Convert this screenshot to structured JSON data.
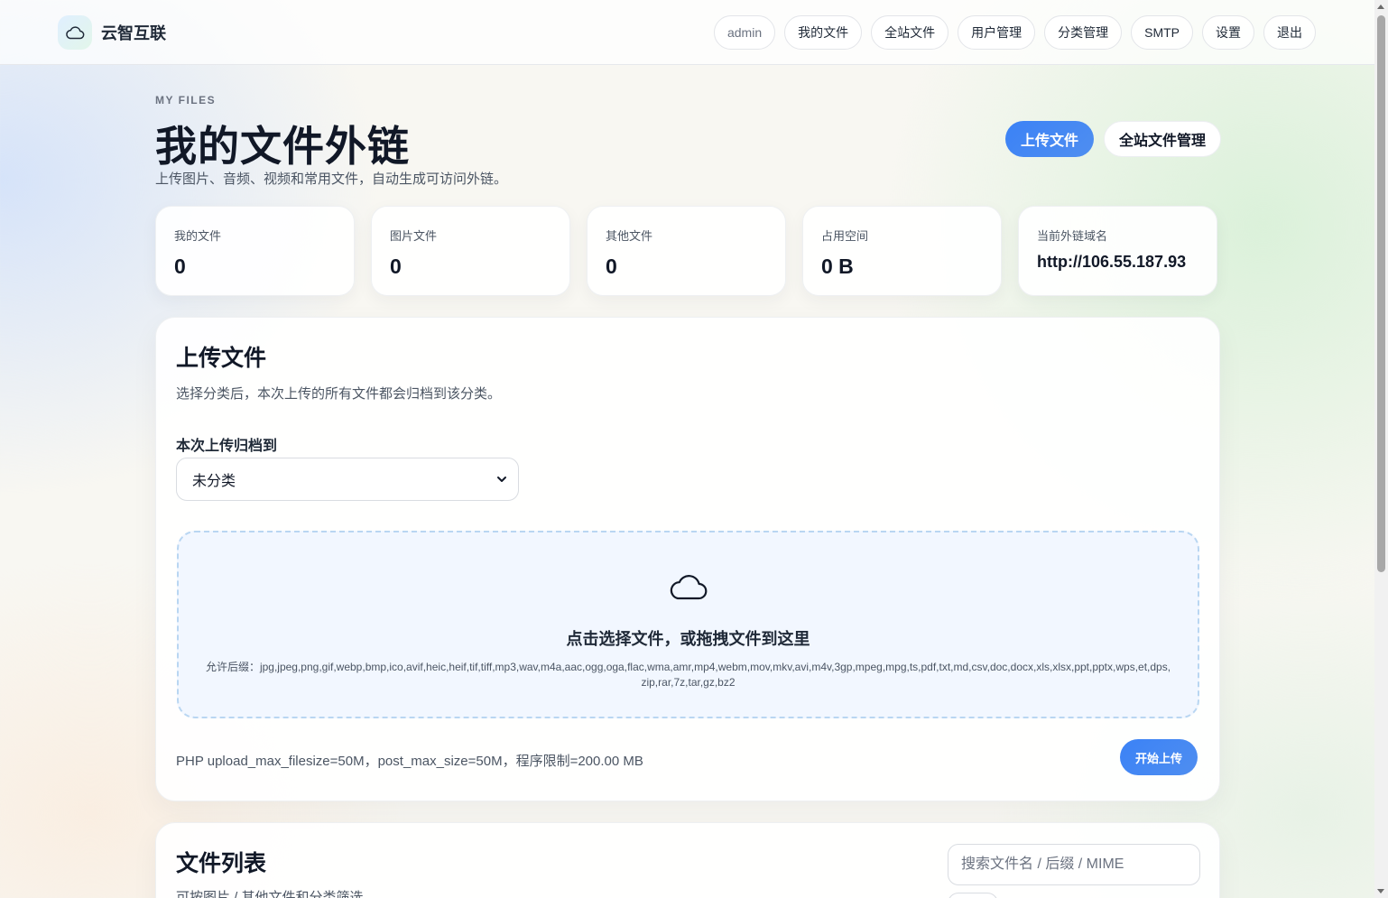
{
  "header": {
    "brand_name": "云智互联",
    "nav": {
      "user": "admin",
      "my_files": "我的文件",
      "site_files": "全站文件",
      "user_mgmt": "用户管理",
      "category_mgmt": "分类管理",
      "smtp": "SMTP",
      "settings": "设置",
      "logout": "退出"
    }
  },
  "hero": {
    "eyebrow": "MY FILES",
    "title": "我的文件外链",
    "subtitle": "上传图片、音频、视频和常用文件，自动生成可访问外链。",
    "upload_button": "上传文件",
    "site_files_button": "全站文件管理"
  },
  "stats": [
    {
      "label": "我的文件",
      "value": "0"
    },
    {
      "label": "图片文件",
      "value": "0"
    },
    {
      "label": "其他文件",
      "value": "0"
    },
    {
      "label": "占用空间",
      "value": "0 B"
    },
    {
      "label": "当前外链域名",
      "value": "http://106.55.187.93"
    }
  ],
  "upload": {
    "title": "上传文件",
    "description": "选择分类后，本次上传的所有文件都会归档到该分类。",
    "category_label": "本次上传归档到",
    "category_selected": "未分类",
    "dropzone_title": "点击选择文件，或拖拽文件到这里",
    "allowed_ext": "允许后缀：jpg,jpeg,png,gif,webp,bmp,ico,avif,heic,heif,tif,tiff,mp3,wav,m4a,aac,ogg,oga,flac,wma,amr,mp4,webm,mov,mkv,avi,m4v,3gp,mpeg,mpg,ts,pdf,txt,md,csv,doc,docx,xls,xlsx,ppt,pptx,wps,et,dps,zip,rar,7z,tar,gz,bz2",
    "limit_text": "PHP upload_max_filesize=50M，post_max_size=50M，程序限制=200.00 MB",
    "start_button": "开始上传"
  },
  "file_list": {
    "title": "文件列表",
    "description": "可按图片 / 其他文件和分类筛选",
    "search_placeholder": "搜索文件名 / 后缀 / MIME"
  },
  "colors": {
    "accent": "#3b82f6",
    "dropzone_bg": "#f2f7ff",
    "dropzone_border": "#b9d6f2"
  }
}
